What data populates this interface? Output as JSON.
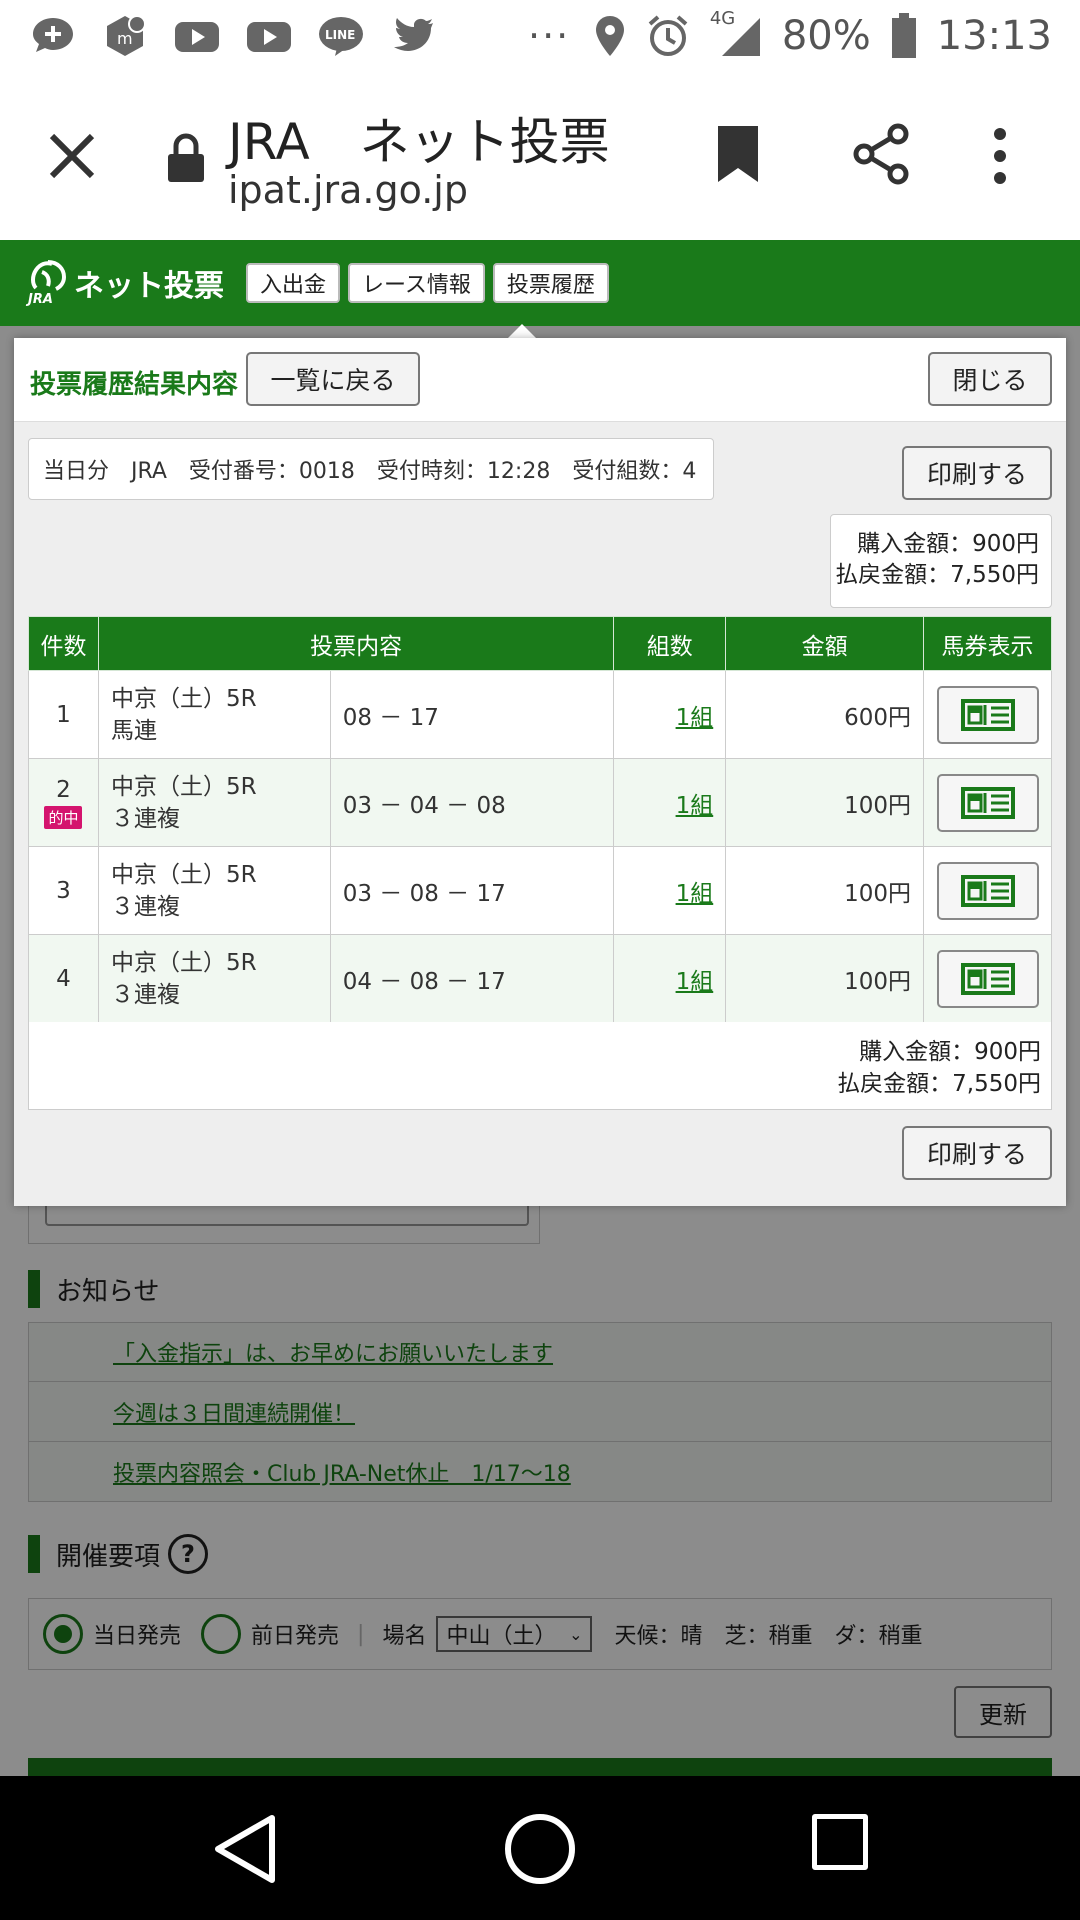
{
  "status_bar": {
    "left_icons": [
      "message-plus-icon",
      "app-icon",
      "youtube-icon",
      "youtube-icon",
      "line-icon",
      "twitter-icon"
    ],
    "more": "···",
    "network": "4G",
    "battery": "80%",
    "time": "13:13"
  },
  "browser": {
    "title": "JRA　ネット投票",
    "url": "ipat.jra.go.jp"
  },
  "site": {
    "logo_text": "ネット投票",
    "logo_sub": "JRA",
    "nav": [
      "入出金",
      "レース情報",
      "投票履歴"
    ]
  },
  "modal": {
    "title": "投票履歴結果内容",
    "back_label": "一覧に戻る",
    "close_label": "閉じる",
    "info": "当日分　JRA　受付番号：0018　受付時刻：12:28　受付組数：4",
    "print_label": "印刷する",
    "purchase": "購入金額：900円",
    "payout": "払戻金額：7,550円",
    "columns": [
      "件数",
      "投票内容",
      "組数",
      "金額",
      "馬券表示"
    ],
    "rows": [
      {
        "num": "1",
        "hit": "",
        "race": "中京（土）5R",
        "type": "馬連",
        "content": "08 － 17",
        "kumi": "1組",
        "amount": "600円"
      },
      {
        "num": "2",
        "hit": "的中",
        "race": "中京（土）5R",
        "type": "３連複",
        "content": "03 － 04 － 08",
        "kumi": "1組",
        "amount": "100円"
      },
      {
        "num": "3",
        "hit": "",
        "race": "中京（土）5R",
        "type": "３連複",
        "content": "03 － 08 － 17",
        "kumi": "1組",
        "amount": "100円"
      },
      {
        "num": "4",
        "hit": "",
        "race": "中京（土）5R",
        "type": "３連複",
        "content": "04 － 08 － 17",
        "kumi": "1組",
        "amount": "100円"
      }
    ]
  },
  "background": {
    "notice_title": "お知らせ",
    "notices": [
      "「入金指示」は、お早めにお願いいたします",
      "今週は３日間連続開催！",
      "投票内容照会・Club JRA-Net休止　1/17～18"
    ],
    "kaisai_title": "開催要項",
    "radio_today": "当日発売",
    "radio_prev": "前日発売",
    "venue_label": "場名",
    "venue_value": "中山（土）",
    "weather": "天候：晴　芝：稍重　ダ：稍重",
    "update_label": "更新"
  },
  "colors": {
    "brand_green": "#1a7a1a",
    "hit_pink": "#d4146e"
  }
}
